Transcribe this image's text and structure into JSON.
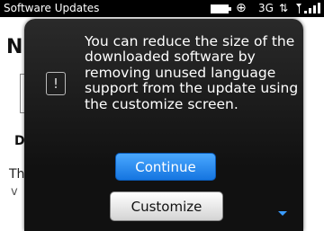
{
  "status_bar": {
    "title": "Software Updates",
    "network": "3G",
    "icons": [
      "battery-icon",
      "gps-icon",
      "data-arrows-icon",
      "signal-icon"
    ]
  },
  "background": {
    "heading_fragment": "N",
    "section_fragment": "D",
    "text_fragment_1": "Th",
    "text_fragment_2": "v"
  },
  "dialog": {
    "icon": "info-icon",
    "message": "You can reduce the size of the downloaded software by removing unused language support from the update using the customize screen.",
    "continue_label": "Continue",
    "customize_label": "Customize",
    "accent_color": "#1e88ff"
  }
}
